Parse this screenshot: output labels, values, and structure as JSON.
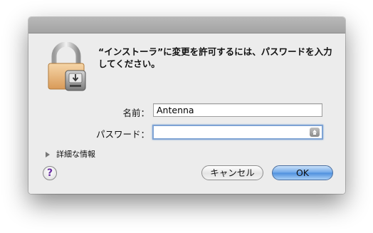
{
  "dialog": {
    "message": "“インストーラ”に変更を許可するには、パスワードを入力してください。",
    "name_label": "名前：",
    "name_value": "Antenna",
    "password_label": "パスワード：",
    "password_value": "",
    "details_label": "詳細な情報",
    "help_label": "?",
    "cancel_label": "キャンセル",
    "ok_label": "OK"
  },
  "icons": {
    "lock": "lock-icon",
    "help": "help-icon",
    "disclosure": "disclosure-triangle-icon",
    "keychain": "keychain-icon"
  },
  "colors": {
    "dialog_bg": "#ececec",
    "focus_ring": "#7ea3d4",
    "default_button": "#5c9ae3"
  }
}
